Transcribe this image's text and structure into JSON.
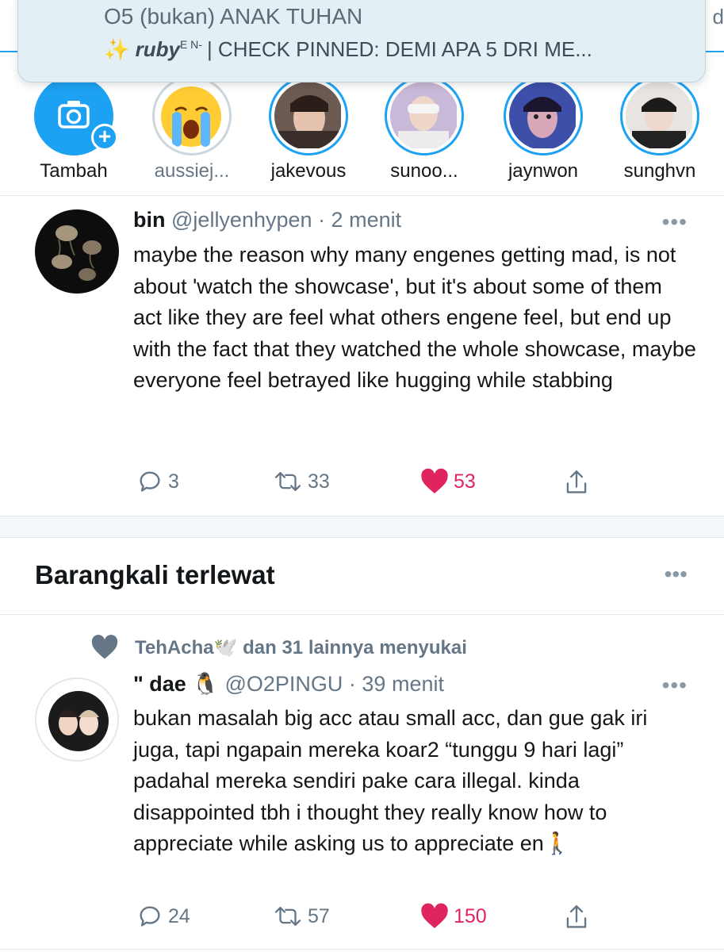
{
  "notification": {
    "line1": "O5 (bukan) ANAK TUHAN",
    "sparkle": "✨",
    "user": "ruby",
    "user_sup": "E N-",
    "message": "| CHECK PINNED: DEMI APA 5 DRI ME..."
  },
  "topbar": {
    "fragment": "d"
  },
  "stories": [
    {
      "label": "Tambah",
      "icon": "camera-icon"
    },
    {
      "label": "aussiej..."
    },
    {
      "label": "jakevous"
    },
    {
      "label": "sunoo..."
    },
    {
      "label": "jaynwon"
    },
    {
      "label": "sunghvn"
    }
  ],
  "tweet1": {
    "name": "bin",
    "handle": "@jellyenhypen",
    "time": "· 2 menit",
    "more": "•••",
    "text": "maybe the reason why many engenes getting mad, is not about 'watch the showcase', but it's about some of them act like they are feel what others engene feel, but end up with the fact that they watched the whole showcase, maybe everyone feel betrayed like hugging while stabbing",
    "replies": "3",
    "retweets": "33",
    "likes": "53"
  },
  "section": {
    "title": "Barangkali terlewat",
    "more": "•••"
  },
  "tweet2": {
    "social_context": "TehAcha🕊️ dan 31 lainnya menyukai",
    "name": "\" dae 🐧",
    "handle": "@O2PINGU",
    "time": "· 39 menit",
    "more": "•••",
    "text": "bukan masalah big acc atau small acc, dan gue gak iri juga, tapi ngapain mereka koar2 “tunggu 9 hari lagi” padahal mereka sendiri pake cara illegal. kinda disappointed tbh i thought they really know how to appreciate while asking us to appreciate en🚶",
    "replies": "24",
    "retweets": "57",
    "likes": "150"
  },
  "colors": {
    "accent": "#1da1f2",
    "like": "#e0245e",
    "muted": "#657786"
  }
}
